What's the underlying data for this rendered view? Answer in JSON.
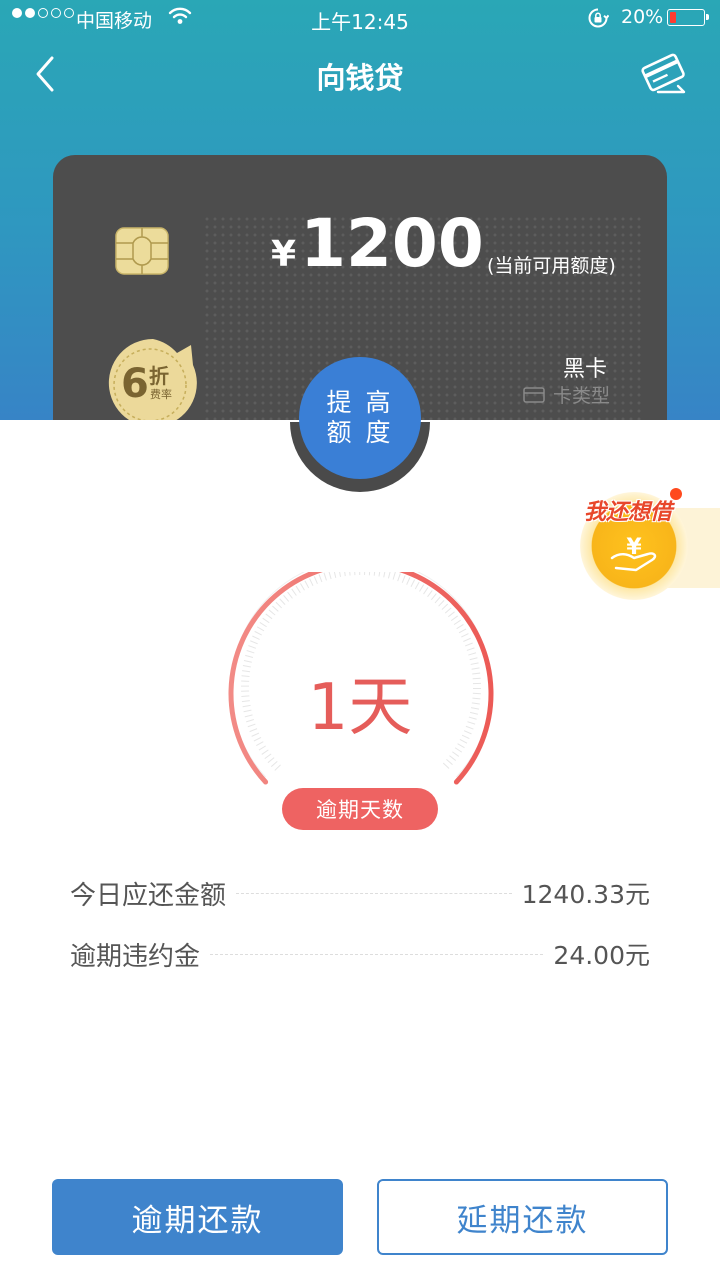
{
  "status_bar": {
    "carrier": "中国移动",
    "time": "上午12:45",
    "battery": "20%",
    "icons": [
      "signal-dots-icon",
      "wifi-icon",
      "rotation-lock-icon",
      "battery-icon"
    ]
  },
  "nav": {
    "title": "向钱贷",
    "back_icon": "chevron-left-icon",
    "right_icon": "card-icon"
  },
  "card": {
    "currency": "¥",
    "amount": "1200",
    "amount_note": "(当前可用额度)",
    "discount_number": "6",
    "discount_char": "折",
    "discount_sub": "费率",
    "type_value": "黑卡",
    "type_label": "卡类型"
  },
  "raise_limit": {
    "line1": "提 高",
    "line2": "额 度"
  },
  "borrow_more": {
    "text": "我还想借",
    "coin_symbol": "¥"
  },
  "overdue": {
    "days": "1天",
    "label": "逾期天数",
    "gauge_fraction": 1.0
  },
  "info": [
    {
      "label": "今日应还金额",
      "value": "1240.33元"
    },
    {
      "label": "逾期违约金",
      "value": "24.00元"
    }
  ],
  "actions": {
    "overdue_repay": "逾期还款",
    "extend_repay": "延期还款"
  },
  "colors": {
    "header_top": "#2aa7b6",
    "header_bottom": "#3784c6",
    "card_bg": "#4d4d4d",
    "accent_blue": "#3f84cc",
    "overdue_red": "#ee6362"
  }
}
